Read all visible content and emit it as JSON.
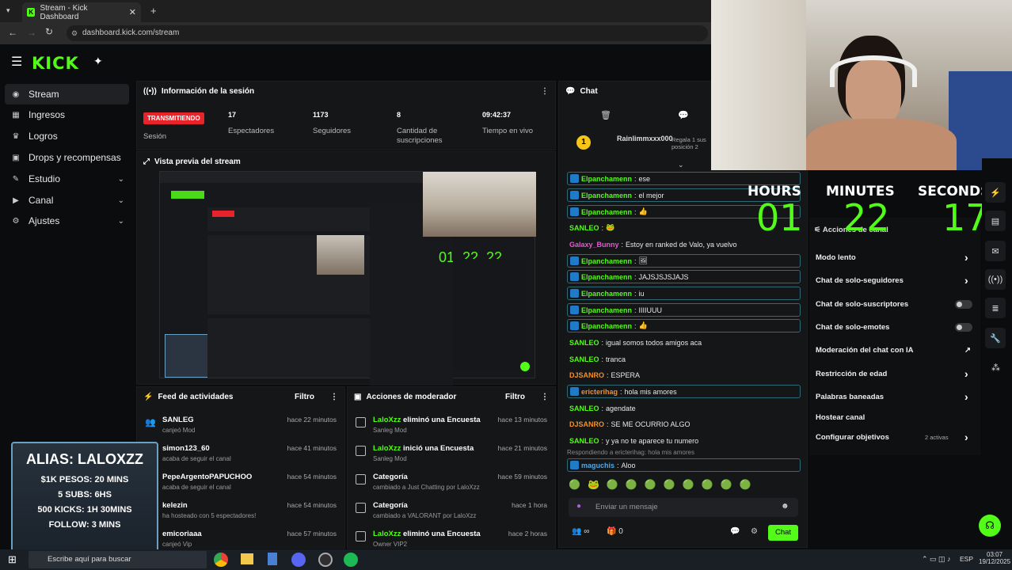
{
  "browser": {
    "tab_title": "Stream - Kick Dashboard",
    "url": "dashboard.kick.com/stream"
  },
  "logo": "KICK",
  "sidebar": {
    "items": [
      {
        "label": "Stream",
        "icon": "stream-icon"
      },
      {
        "label": "Ingresos",
        "icon": "revenue-icon"
      },
      {
        "label": "Logros",
        "icon": "trophy-icon"
      },
      {
        "label": "Drops y recompensas",
        "icon": "gift-icon"
      },
      {
        "label": "Estudio",
        "icon": "palette-icon"
      },
      {
        "label": "Canal",
        "icon": "channel-icon"
      },
      {
        "label": "Ajustes",
        "icon": "gear-icon"
      }
    ]
  },
  "session": {
    "title": "Información de la sesión",
    "live_badge": "TRANSMITIENDO",
    "session_label": "Sesión",
    "stats": [
      {
        "value": "17",
        "label": "Espectadores"
      },
      {
        "value": "1173",
        "label": "Seguidores"
      },
      {
        "value": "8",
        "label": "Cantidad de suscripciones"
      },
      {
        "value": "09:42:37",
        "label": "Tiempo en vivo"
      }
    ]
  },
  "preview": {
    "title": "Vista previa del stream"
  },
  "activity": {
    "title": "Feed de actividades",
    "filter": "Filtro",
    "rows": [
      {
        "name": "SANLEG",
        "detail": "canjeó Mod",
        "time": "hace 22 minutos"
      },
      {
        "name": "simon123_60",
        "detail": "acaba de seguir el canal",
        "time": "hace 41 minutos"
      },
      {
        "name": "PepeArgentoPAPUCHOO",
        "detail": "acaba de seguir el canal",
        "time": "hace 54 minutos"
      },
      {
        "name": "kelezin",
        "detail": "ha hosteado con 5 espectadores!",
        "time": "hace 54 minutos"
      },
      {
        "name": "emicoriaaa",
        "detail": "canjeó Vip",
        "time": "hace 57 minutos"
      }
    ]
  },
  "mod_actions": {
    "title": "Acciones de moderador",
    "filter": "Filtro",
    "rows": [
      {
        "title_a": "LaloXzz",
        "title_b": " eliminó una Encuesta",
        "detail": "Sanleg Mod",
        "time": "hace 13 minutos"
      },
      {
        "title_a": "LaloXzz",
        "title_b": " inició una Encuesta",
        "detail": "Sanleg Mod",
        "time": "hace 21 minutos"
      },
      {
        "title_a": "",
        "title_b": "Categoría",
        "detail": "cambiado a Just Chatting por LaloXzz",
        "time": "hace 59 minutos"
      },
      {
        "title_a": "",
        "title_b": "Categoría",
        "detail": "cambiado a VALORANT por LaloXzz",
        "time": "hace 1 hora"
      },
      {
        "title_a": "LaloXzz",
        "title_b": " eliminó una Encuesta",
        "detail": "Owner VIP2",
        "time": "hace 2 horas"
      }
    ]
  },
  "chat": {
    "title": "Chat",
    "pinned_user": "Rainlimmxxx000",
    "pinned_note": "Regala 1 sus posición 2",
    "messages": [
      {
        "user": "Elpanchamenn",
        "text": "ese",
        "color": "#53fc18",
        "boxed": true
      },
      {
        "user": "Elpanchamenn",
        "text": "el mejor",
        "color": "#53fc18",
        "boxed": true
      },
      {
        "user": "Elpanchamenn",
        "text": "👍",
        "color": "#53fc18",
        "boxed": true
      },
      {
        "user": "SANLEO",
        "text": "🐸",
        "color": "#53fc18",
        "boxed": false
      },
      {
        "user": "Galaxy_Bunny",
        "text": "Estoy en ranked de Valo, ya vuelvo",
        "color": "#e05bd0",
        "boxed": false
      },
      {
        "user": "Elpanchamenn",
        "text": "🖼",
        "color": "#53fc18",
        "boxed": true
      },
      {
        "user": "Elpanchamenn",
        "text": "JAJSJSJSJAJS",
        "color": "#53fc18",
        "boxed": true
      },
      {
        "user": "Elpanchamenn",
        "text": "iu",
        "color": "#53fc18",
        "boxed": true
      },
      {
        "user": "Elpanchamenn",
        "text": "IIIIUUU",
        "color": "#53fc18",
        "boxed": true
      },
      {
        "user": "Elpanchamenn",
        "text": "👍",
        "color": "#53fc18",
        "boxed": true
      },
      {
        "user": "SANLEO",
        "text": "igual somos todos amigos aca",
        "color": "#53fc18",
        "boxed": false
      },
      {
        "user": "SANLEO",
        "text": "tranca",
        "color": "#53fc18",
        "boxed": false
      },
      {
        "user": "DJSANRO",
        "text": "ESPERA",
        "color": "#f0902a",
        "boxed": false
      },
      {
        "user": "ericterihag",
        "text": "hola mis amores",
        "color": "#f0902a",
        "boxed": true
      },
      {
        "user": "SANLEO",
        "text": "agendate",
        "color": "#53fc18",
        "boxed": false
      },
      {
        "user": "DJSANRO",
        "text": "SE ME OCURRIO ALGO",
        "color": "#f0902a",
        "boxed": false
      },
      {
        "user": "SANLEO",
        "text": "y ya no te aparece tu numero",
        "color": "#53fc18",
        "boxed": false
      }
    ],
    "reply_context": "Respondiendo a ericterihag: hola mis amores",
    "reply_user": "maguchis",
    "reply_text": "Aloo",
    "input_placeholder": "Enviar un mensaje",
    "send_label": "Chat",
    "count_a": "∞",
    "count_b": "0"
  },
  "timer": {
    "hours_label": "HOURS",
    "minutes_label": "MINUTES",
    "seconds_label": "SECONDS",
    "hours": "01",
    "minutes": "22",
    "seconds": "17"
  },
  "moderation": {
    "title": "Acciones de canal",
    "items": [
      {
        "label": "Modo lento",
        "control": "arrow"
      },
      {
        "label": "Chat de solo-seguidores",
        "control": "arrow"
      },
      {
        "label": "Chat de solo-suscriptores",
        "control": "toggle"
      },
      {
        "label": "Chat de solo-emotes",
        "control": "toggle"
      },
      {
        "label": "Moderación del chat con IA",
        "control": "link"
      },
      {
        "label": "Restricción de edad",
        "control": "arrow"
      },
      {
        "label": "Palabras baneadas",
        "control": "arrow"
      },
      {
        "label": "Hostear canal",
        "control": "none"
      },
      {
        "label": "Configurar objetivos",
        "control": "arrow",
        "extra": "2 activas"
      }
    ]
  },
  "alias_overlay": {
    "title": "ALIAS: LALOXZZ",
    "lines": [
      "$1K PESOS: 20 MINS",
      "5 SUBS: 6HS",
      "500 KICKS: 1H 30MINS",
      "FOLLOW: 3 MINS"
    ]
  },
  "taskbar": {
    "search_placeholder": "Escribe aquí para buscar",
    "lang": "ESP",
    "time": "03:07",
    "date": "19/12/2025"
  },
  "colors": {
    "accent": "#53fc18",
    "live": "#e8232a",
    "panel": "#151618"
  }
}
